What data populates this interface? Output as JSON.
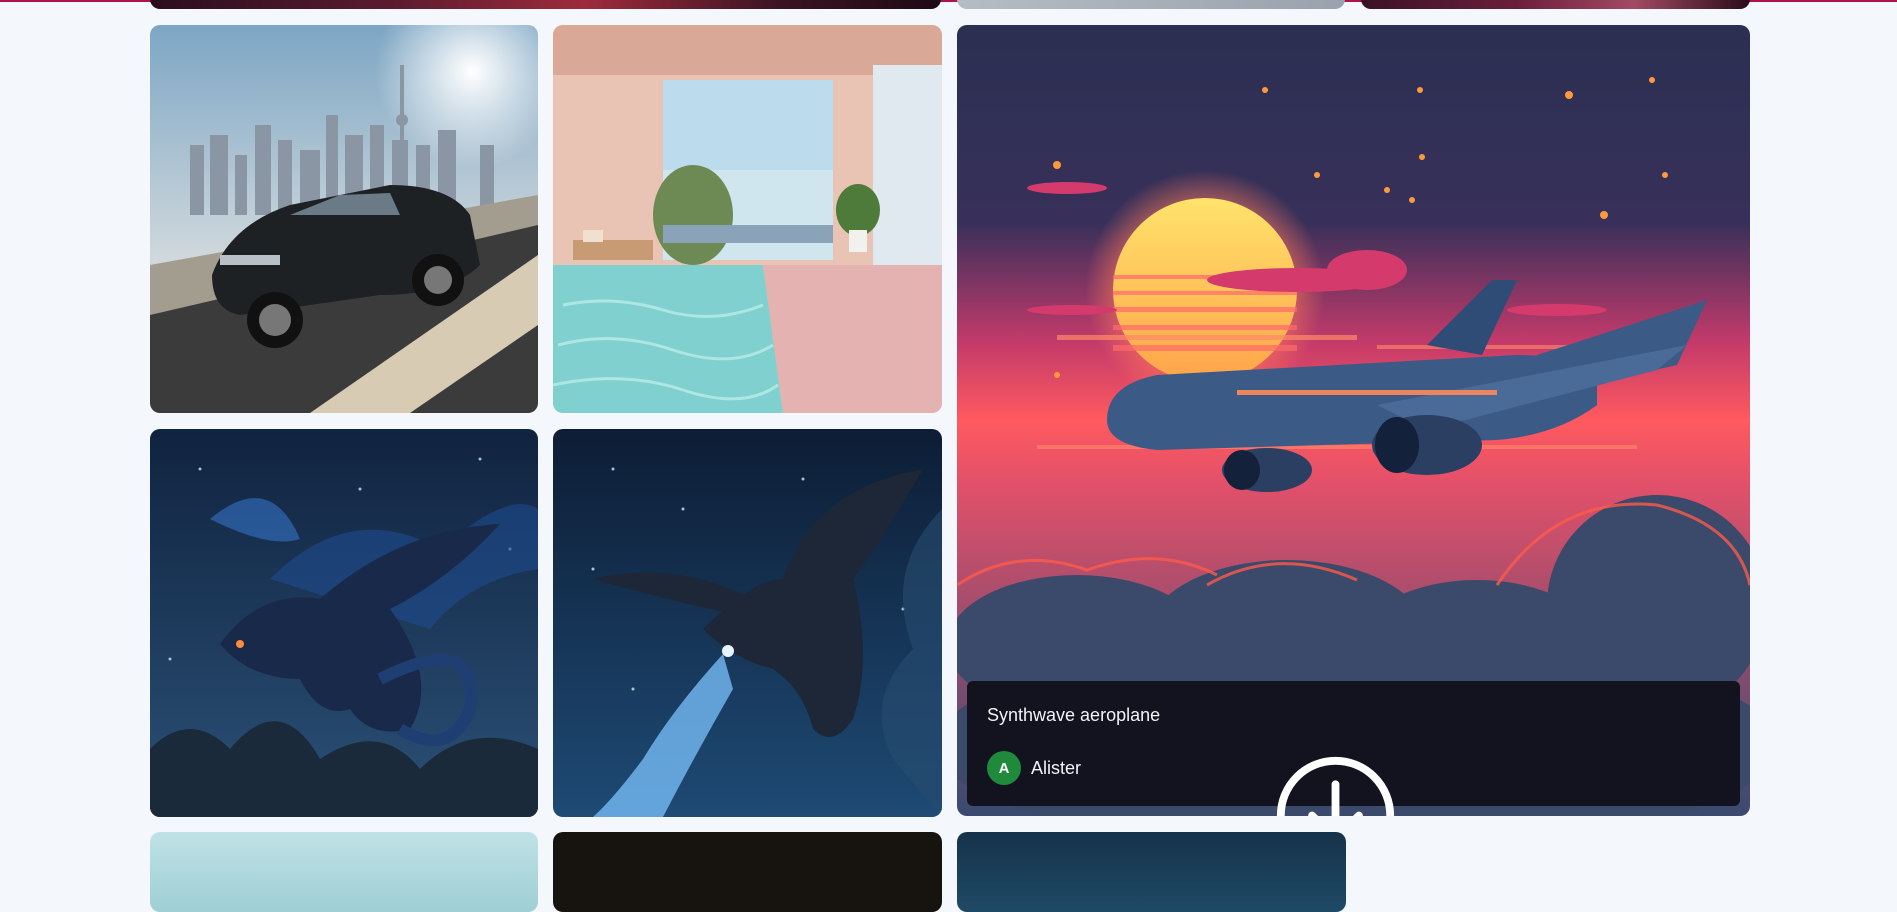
{
  "featured": {
    "title": "Synthwave aeroplane",
    "author": {
      "initial": "A",
      "name": "Alister",
      "avatar_color": "#1f8a3c"
    },
    "download_icon": "download-circle-icon"
  },
  "gallery": {
    "items": [
      {
        "subject": "luxury sedan on highway with city skyline"
      },
      {
        "subject": "minimalist room with indoor pool"
      },
      {
        "subject": "synthwave aeroplane over clouds at sunset"
      },
      {
        "subject": "blue fire dragon flying at night"
      },
      {
        "subject": "dark dragon breathing blue fire in starry sky"
      }
    ]
  },
  "colors": {
    "accent_bar": "#b0124a",
    "page_background": "#f4f7fb",
    "overlay_background": "#12131f"
  }
}
